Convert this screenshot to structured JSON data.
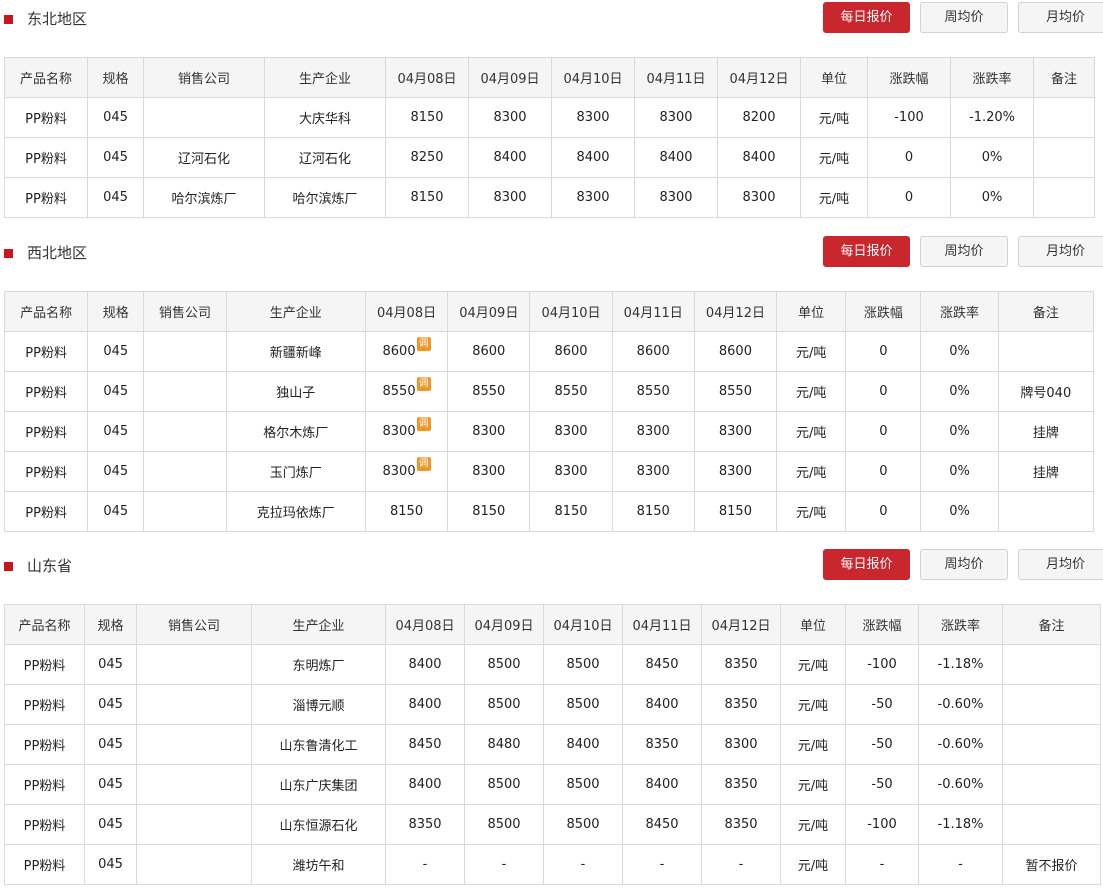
{
  "buttons": {
    "daily": "每日报价",
    "weekly": "周均价",
    "monthly": "月均价"
  },
  "colors": {
    "accent": "#c9262e",
    "up": "#e02020",
    "down": "#3bb83b",
    "product_link": "#2a6fd6",
    "adjust_badge": "#f19527"
  },
  "adjust_badge": "调",
  "sections": [
    {
      "title": "东北地区",
      "headers": [
        "产品名称",
        "规格",
        "销售公司",
        "生产企业",
        "04月08日",
        "04月09日",
        "04月10日",
        "04月11日",
        "04月12日",
        "单位",
        "涨跌幅",
        "涨跌率",
        "备注"
      ],
      "rows": [
        {
          "cells": [
            "PP粉料",
            "045",
            "",
            "大庆华科",
            "8150",
            "8300",
            "8300",
            "8300",
            "8200",
            "元/吨",
            "-100",
            "-1.20%",
            ""
          ],
          "colors": [
            "",
            "",
            "",
            "",
            "",
            "up",
            "",
            "",
            "down",
            "",
            "down",
            "down",
            ""
          ]
        },
        {
          "cells": [
            "PP粉料",
            "045",
            "辽河石化",
            "辽河石化",
            "8250",
            "8400",
            "8400",
            "8400",
            "8400",
            "元/吨",
            "0",
            "0%",
            ""
          ],
          "colors": [
            "",
            "",
            "",
            "",
            "",
            "up",
            "",
            "",
            "",
            "",
            "",
            "",
            ""
          ]
        },
        {
          "cells": [
            "PP粉料",
            "045",
            "哈尔滨炼厂",
            "哈尔滨炼厂",
            "8150",
            "8300",
            "8300",
            "8300",
            "8300",
            "元/吨",
            "0",
            "0%",
            ""
          ],
          "colors": [
            "",
            "",
            "",
            "",
            "",
            "up",
            "",
            "",
            "",
            "",
            "",
            "",
            ""
          ]
        }
      ]
    },
    {
      "title": "西北地区",
      "headers": [
        "产品名称",
        "规格",
        "销售公司",
        "生产企业",
        "04月08日",
        "04月09日",
        "04月10日",
        "04月11日",
        "04月12日",
        "单位",
        "涨跌幅",
        "涨跌率",
        "备注"
      ],
      "rows": [
        {
          "cells": [
            "PP粉料",
            "045",
            "",
            "新疆新峰",
            "8600",
            "8600",
            "8600",
            "8600",
            "8600",
            "元/吨",
            "0",
            "0%",
            ""
          ],
          "colors": [],
          "adjusted": true
        },
        {
          "cells": [
            "PP粉料",
            "045",
            "",
            "独山子",
            "8550",
            "8550",
            "8550",
            "8550",
            "8550",
            "元/吨",
            "0",
            "0%",
            "牌号040"
          ],
          "colors": [],
          "adjusted": true
        },
        {
          "cells": [
            "PP粉料",
            "045",
            "",
            "格尔木炼厂",
            "8300",
            "8300",
            "8300",
            "8300",
            "8300",
            "元/吨",
            "0",
            "0%",
            "挂牌"
          ],
          "colors": [],
          "adjusted": true
        },
        {
          "cells": [
            "PP粉料",
            "045",
            "",
            "玉门炼厂",
            "8300",
            "8300",
            "8300",
            "8300",
            "8300",
            "元/吨",
            "0",
            "0%",
            "挂牌"
          ],
          "colors": [],
          "adjusted": true
        },
        {
          "cells": [
            "PP粉料",
            "045",
            "",
            "克拉玛依炼厂",
            "8150",
            "8150",
            "8150",
            "8150",
            "8150",
            "元/吨",
            "0",
            "0%",
            ""
          ],
          "colors": []
        }
      ]
    },
    {
      "title": "山东省",
      "headers": [
        "产品名称",
        "规格",
        "销售公司",
        "生产企业",
        "04月08日",
        "04月09日",
        "04月10日",
        "04月11日",
        "04月12日",
        "单位",
        "涨跌幅",
        "涨跌率",
        "备注"
      ],
      "rows": [
        {
          "cells": [
            "PP粉料",
            "045",
            "",
            "东明炼厂",
            "8400",
            "8500",
            "8500",
            "8450",
            "8350",
            "元/吨",
            "-100",
            "-1.18%",
            ""
          ],
          "colors": [
            "",
            "",
            "",
            "",
            "down",
            "up",
            "",
            "down",
            "down",
            "",
            "down",
            "down",
            ""
          ]
        },
        {
          "cells": [
            "PP粉料",
            "045",
            "",
            "淄博元顺",
            "8400",
            "8500",
            "8500",
            "8400",
            "8350",
            "元/吨",
            "-50",
            "-0.60%",
            ""
          ],
          "colors": [
            "",
            "",
            "",
            "",
            "up",
            "up",
            "",
            "down",
            "down",
            "",
            "down",
            "down",
            ""
          ]
        },
        {
          "cells": [
            "PP粉料",
            "045",
            "",
            "山东鲁清化工",
            "8450",
            "8480",
            "8400",
            "8350",
            "8300",
            "元/吨",
            "-50",
            "-0.60%",
            ""
          ],
          "colors": [
            "",
            "",
            "",
            "",
            "up",
            "up",
            "down",
            "down",
            "down",
            "",
            "down",
            "down",
            ""
          ]
        },
        {
          "cells": [
            "PP粉料",
            "045",
            "",
            "山东广庆集团",
            "8400",
            "8500",
            "8500",
            "8400",
            "8350",
            "元/吨",
            "-50",
            "-0.60%",
            ""
          ],
          "colors": [
            "",
            "",
            "",
            "",
            "",
            "up",
            "",
            "down",
            "down",
            "",
            "down",
            "down",
            ""
          ]
        },
        {
          "cells": [
            "PP粉料",
            "045",
            "",
            "山东恒源石化",
            "8350",
            "8500",
            "8500",
            "8450",
            "8350",
            "元/吨",
            "-100",
            "-1.18%",
            ""
          ],
          "colors": [
            "",
            "",
            "",
            "",
            "up",
            "up",
            "",
            "down",
            "down",
            "",
            "down",
            "down",
            ""
          ]
        },
        {
          "cells": [
            "PP粉料",
            "045",
            "",
            "潍坊午和",
            "-",
            "-",
            "-",
            "-",
            "-",
            "元/吨",
            "-",
            "-",
            "暂不报价"
          ],
          "colors": []
        }
      ]
    }
  ]
}
